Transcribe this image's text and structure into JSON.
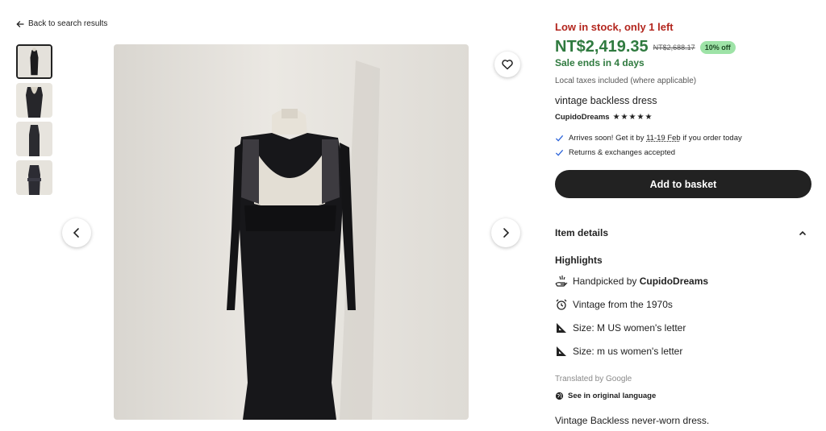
{
  "nav": {
    "back_label": "Back to search results"
  },
  "listing": {
    "stock_message": "Low in stock, only 1 left",
    "price": "NT$2,419.35",
    "original_price": "NT$2,688.17",
    "discount": "10% off",
    "sale_ends": "Sale ends in 4 days",
    "taxes_note": "Local taxes included (where applicable)",
    "title": "vintage backless dress",
    "shop_name": "CupidoDreams",
    "rating_stars": "★★★★★",
    "rating_value": 5,
    "arrival_prefix": "Arrives soon! Get it by ",
    "arrival_dates": "11-19 Feb",
    "arrival_suffix": " if you order today",
    "returns": "Returns & exchanges accepted",
    "add_to_basket": "Add to basket"
  },
  "gallery": {
    "thumbnail_count": 4,
    "active_index": 0
  },
  "details": {
    "header": "Item details",
    "highlights_title": "Highlights",
    "handpicked_prefix": "Handpicked by ",
    "handpicked_shop": "CupidoDreams",
    "vintage": "Vintage from the 1970s",
    "size_1": "Size: M US women's letter",
    "size_2": "Size: m us women's letter",
    "translated_by": "Translated by Google",
    "see_original": "See in original language",
    "description": "Vintage Backless never-worn dress."
  },
  "colors": {
    "stock_red": "#b3261e",
    "price_green": "#2f7a3f",
    "discount_bg": "#9ee3a7",
    "button_dark": "#222222"
  },
  "icons": {
    "back": "arrow-left-icon",
    "favorite": "heart-icon",
    "prev": "chevron-left-icon",
    "next": "chevron-right-icon",
    "check": "check-icon",
    "collapse": "chevron-up-icon",
    "handpicked": "hand-icon",
    "vintage": "alarm-clock-icon",
    "size": "ruler-icon",
    "language": "globe-icon"
  }
}
